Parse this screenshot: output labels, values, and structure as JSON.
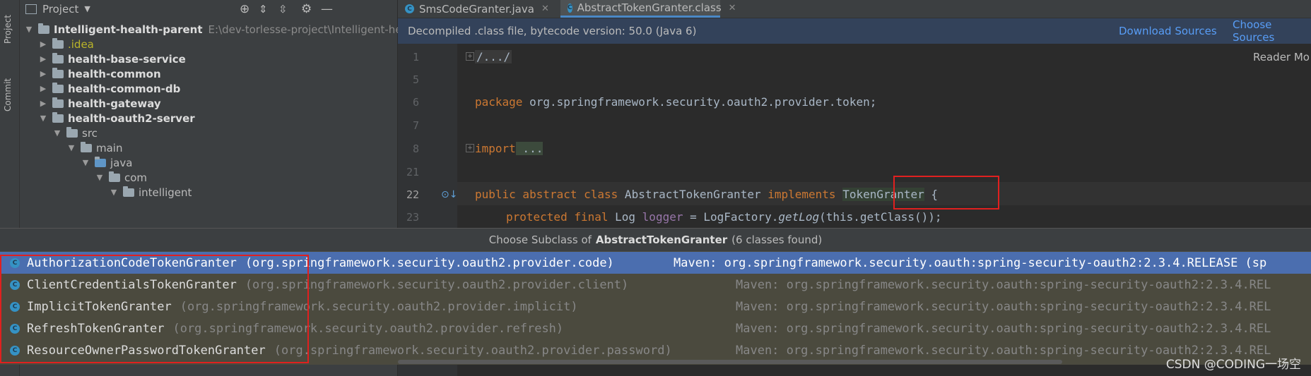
{
  "sidebar": {
    "project_label": "Project",
    "commit_label": "Commit"
  },
  "project_panel": {
    "title": "Project",
    "tree": [
      {
        "label": "Intelligent-health-parent",
        "path": "E:\\dev-torlesse-project\\Intelligent-heal"
      },
      {
        "label": ".idea"
      },
      {
        "label": "health-base-service"
      },
      {
        "label": "health-common"
      },
      {
        "label": "health-common-db"
      },
      {
        "label": "health-gateway"
      },
      {
        "label": "health-oauth2-server"
      },
      {
        "label": "src"
      },
      {
        "label": "main"
      },
      {
        "label": "java"
      },
      {
        "label": "com"
      },
      {
        "label": "intelligent"
      }
    ]
  },
  "tabs": [
    {
      "label": "SmsCodeGranter.java"
    },
    {
      "label": "AbstractTokenGranter.class"
    }
  ],
  "banner": {
    "message": "Decompiled .class file, bytecode version: 50.0 (Java 6)",
    "download_sources": "Download Sources",
    "choose_sources": "Choose Sources"
  },
  "editor": {
    "reader_mode": "Reader Mo",
    "lines": [
      {
        "num": "1",
        "text": "/.../"
      },
      {
        "num": "5",
        "text": ""
      },
      {
        "num": "6",
        "kw": "package",
        "text": " org.springframework.security.oauth2.provider.token;"
      },
      {
        "num": "7",
        "text": ""
      },
      {
        "num": "8",
        "kw": "import",
        "text": " ..."
      },
      {
        "num": "21",
        "text": ""
      },
      {
        "num": "22",
        "kw": "public abstract class",
        "mid": " AbstractTokenGranter ",
        "kw2": "implements",
        "type": "TokenGranter",
        "tail": " {"
      },
      {
        "num": "23",
        "kw": "protected final",
        "mid": " Log ",
        "fld": "logger",
        "tail": " = LogFactory.",
        "it": "getLog",
        "tail2": "(this.getClass());"
      }
    ]
  },
  "popup": {
    "title_prefix": "Choose Subclass of",
    "title_class": "AbstractTokenGranter",
    "title_suffix": "(6 classes found)",
    "items": [
      {
        "name": "AuthorizationCodeTokenGranter",
        "package": "(org.springframework.security.oauth2.provider.code)",
        "maven": "Maven: org.springframework.security.oauth:spring-security-oauth2:2.3.4.RELEASE (sp"
      },
      {
        "name": "ClientCredentialsTokenGranter",
        "package": "(org.springframework.security.oauth2.provider.client)",
        "maven": "Maven: org.springframework.security.oauth:spring-security-oauth2:2.3.4.REL"
      },
      {
        "name": "ImplicitTokenGranter",
        "package": "(org.springframework.security.oauth2.provider.implicit)",
        "maven": "Maven: org.springframework.security.oauth:spring-security-oauth2:2.3.4.REL"
      },
      {
        "name": "RefreshTokenGranter",
        "package": "(org.springframework.security.oauth2.provider.refresh)",
        "maven": "Maven: org.springframework.security.oauth:spring-security-oauth2:2.3.4.REL"
      },
      {
        "name": "ResourceOwnerPasswordTokenGranter",
        "package": "(org.springframework.security.oauth2.provider.password)",
        "maven": "Maven: org.springframework.security.oauth:spring-security-oauth2:2.3.4.REL"
      }
    ]
  },
  "watermark": "CSDN @CODING一场空",
  "colors": {
    "selection": "#4b6eaf",
    "keyword": "#cc7832",
    "highlight_box": "#e0201f",
    "link": "#589df6"
  }
}
